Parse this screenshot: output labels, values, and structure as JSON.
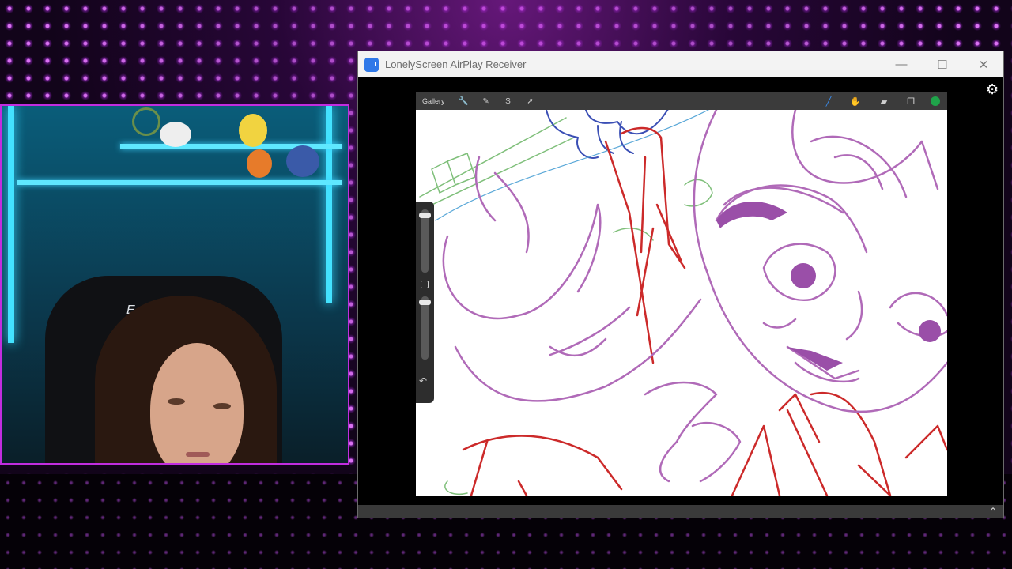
{
  "window": {
    "title": "LonelyScreen AirPlay Receiver",
    "minimize_label": "—",
    "maximize_label": "☐",
    "close_label": "✕"
  },
  "icons": {
    "settings": "⚙",
    "collapse": "⌃"
  },
  "procreate": {
    "gallery_label": "Gallery",
    "tools_left": [
      {
        "name": "actions",
        "glyph": "🔧"
      },
      {
        "name": "adjustments",
        "glyph": "✎"
      },
      {
        "name": "selection",
        "glyph": "S"
      },
      {
        "name": "transform",
        "glyph": "➚"
      }
    ],
    "tools_right": [
      {
        "name": "brush",
        "glyph": "╱"
      },
      {
        "name": "smudge",
        "glyph": "✋"
      },
      {
        "name": "eraser",
        "glyph": "▰"
      },
      {
        "name": "layers",
        "glyph": "❐"
      }
    ],
    "active_color": "#1fa34a",
    "undo_glyph": "↶",
    "stroke_colors": {
      "purple": "#b06ab8",
      "red": "#cc2a2a",
      "green": "#3fa34a",
      "blue": "#3b4fb5"
    }
  },
  "webcam": {
    "chair_brand": "E-W"
  },
  "colors": {
    "accent_purple": "#c12de0",
    "led_cyan": "#43e2ff"
  }
}
